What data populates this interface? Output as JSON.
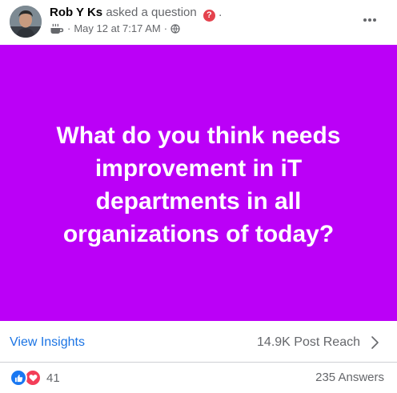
{
  "post": {
    "author": "Rob Y Ks",
    "action": "asked a question",
    "action_suffix": ".",
    "question_badge_icon": "question-mark",
    "activity_icon": "coffee-cup",
    "separator": "·",
    "timestamp": "May 12 at 7:17 AM",
    "audience_icon": "globe",
    "more_icon": "horizontal-ellipsis"
  },
  "banner": {
    "background_color": "#bb00f7",
    "text_color": "#ffffff",
    "text": "What do you think needs improvement in iT departments in all organizations of today?"
  },
  "insights": {
    "view_label": "View Insights",
    "reach_label": "14.9K Post Reach",
    "chevron_icon": "chevron-right"
  },
  "footer": {
    "reaction_icons": [
      "like",
      "love"
    ],
    "reaction_count": "41",
    "answers_label": "235 Answers"
  },
  "colors": {
    "link_blue": "#1b74e4",
    "secondary_text": "#65676b",
    "like_blue": "#1877f2",
    "love_red": "#f33e58"
  }
}
